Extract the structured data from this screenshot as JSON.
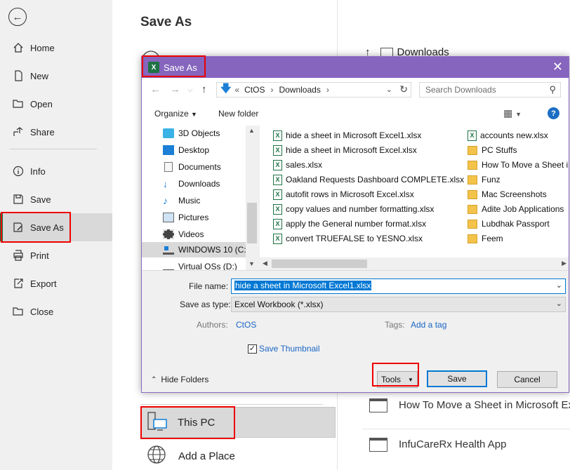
{
  "backstage": {
    "nav": [
      {
        "label": "Home",
        "icon": "home-icon"
      },
      {
        "label": "New",
        "icon": "new-document-icon"
      },
      {
        "label": "Open",
        "icon": "open-folder-icon"
      },
      {
        "label": "Share",
        "icon": "share-icon"
      },
      {
        "label": "Info",
        "icon": "info-icon"
      },
      {
        "label": "Save",
        "icon": "save-icon"
      },
      {
        "label": "Save As",
        "icon": "save-as-icon",
        "active": true
      },
      {
        "label": "Print",
        "icon": "print-icon"
      },
      {
        "label": "Export",
        "icon": "export-icon"
      },
      {
        "label": "Close",
        "icon": "close-doc-icon"
      }
    ],
    "title": "Save As",
    "locations": {
      "this_pc": "This PC",
      "add_place": "Add a Place"
    },
    "breadcrumb_bg": "Downloads",
    "recent": [
      "How To Move a Sheet in Microsoft Ex",
      "InfuCareRx Health App"
    ]
  },
  "dialog": {
    "title": "Save As",
    "address": {
      "root": "CtOS",
      "folder": "Downloads"
    },
    "search_placeholder": "Search Downloads",
    "organize_label": "Organize",
    "new_folder_label": "New folder",
    "tree": [
      {
        "label": "3D Objects",
        "icon": "3d-objects-icon"
      },
      {
        "label": "Desktop",
        "icon": "desktop-icon"
      },
      {
        "label": "Documents",
        "icon": "documents-icon"
      },
      {
        "label": "Downloads",
        "icon": "downloads-icon"
      },
      {
        "label": "Music",
        "icon": "music-icon"
      },
      {
        "label": "Pictures",
        "icon": "pictures-icon"
      },
      {
        "label": "Videos",
        "icon": "videos-icon"
      },
      {
        "label": "WINDOWS 10 (C:)",
        "icon": "drive-icon",
        "selected": true
      },
      {
        "label": "Virtual OSs (D:)",
        "icon": "drive-icon"
      }
    ],
    "files_col1": [
      "hide a sheet in Microsoft Excel1.xlsx",
      "hide a sheet in Microsoft Excel.xlsx",
      "sales.xlsx",
      "Oakland Requests Dashboard COMPLETE.xlsx",
      "autofit rows in Microsoft Excel.xlsx",
      "copy values and number formatting.xlsx",
      "apply the General number format.xlsx",
      "convert TRUEFALSE to YESNO.xlsx"
    ],
    "files_col2": [
      {
        "label": "accounts new.xlsx",
        "type": "excel"
      },
      {
        "label": "PC Stuffs",
        "type": "folder"
      },
      {
        "label": "How To Move a Sheet in",
        "type": "folder"
      },
      {
        "label": "Funz",
        "type": "folder"
      },
      {
        "label": "Mac Screenshots",
        "type": "folder"
      },
      {
        "label": "Adite Job Applications",
        "type": "folder"
      },
      {
        "label": "Lubdhak Passport",
        "type": "folder"
      },
      {
        "label": "Feem",
        "type": "folder"
      }
    ],
    "form": {
      "filename_label": "File name:",
      "filename_value": "hide a sheet in Microsoft Excel1.xlsx",
      "savetype_label": "Save as type:",
      "savetype_value": "Excel Workbook (*.xlsx)",
      "authors_label": "Authors:",
      "authors_value": "CtOS",
      "tags_label": "Tags:",
      "tags_value": "Add a tag",
      "thumbnail_label": "Save Thumbnail"
    },
    "hide_folders_label": "Hide Folders",
    "tools_label": "Tools",
    "save_label": "Save",
    "cancel_label": "Cancel"
  },
  "colors": {
    "dialog_title": "#8665be",
    "excel_green": "#1f7244",
    "highlight": "#e00000",
    "link": "#1a66c4"
  }
}
